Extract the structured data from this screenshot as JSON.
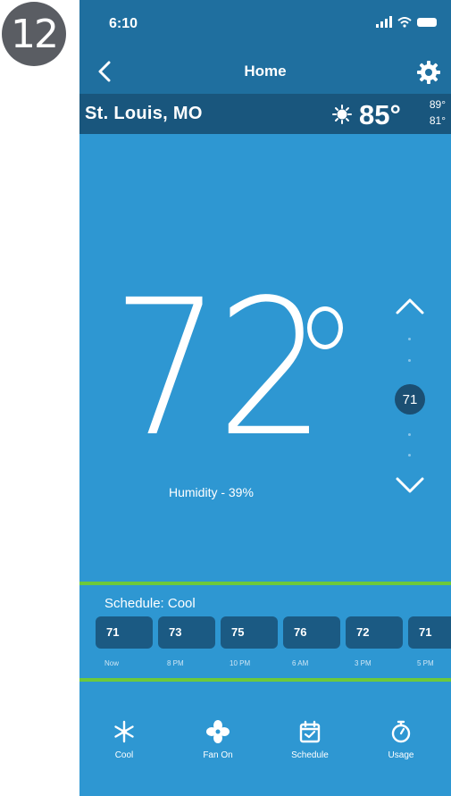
{
  "step_number": "12",
  "status_bar": {
    "time": "6:10"
  },
  "nav": {
    "title": "Home"
  },
  "weather": {
    "city": "St. Louis, MO",
    "current_temp": "85°",
    "high_temp": "89°",
    "low_temp": "81°",
    "icon": "sun-icon"
  },
  "thermostat": {
    "current_temp": "72",
    "humidity": "Humidity - 39%",
    "setpoint": "71"
  },
  "schedule": {
    "label": "Schedule: Cool",
    "slots": [
      {
        "temp": "71",
        "time": "Now"
      },
      {
        "temp": "73",
        "time": "8 PM"
      },
      {
        "temp": "75",
        "time": "10 PM"
      },
      {
        "temp": "76",
        "time": "6 AM"
      },
      {
        "temp": "72",
        "time": "3 PM"
      },
      {
        "temp": "71",
        "time": "5 PM"
      }
    ]
  },
  "tabs": [
    {
      "label": "Cool",
      "icon": "snowflake-icon"
    },
    {
      "label": "Fan On",
      "icon": "fan-icon"
    },
    {
      "label": "Schedule",
      "icon": "calendar-icon"
    },
    {
      "label": "Usage",
      "icon": "stopwatch-icon"
    }
  ],
  "colors": {
    "app_background": "#2e97d2",
    "header": "#1f6f9f",
    "weather_bar": "#19567d",
    "schedule_slot": "#1b5a83",
    "highlight": "#6dc93b"
  }
}
